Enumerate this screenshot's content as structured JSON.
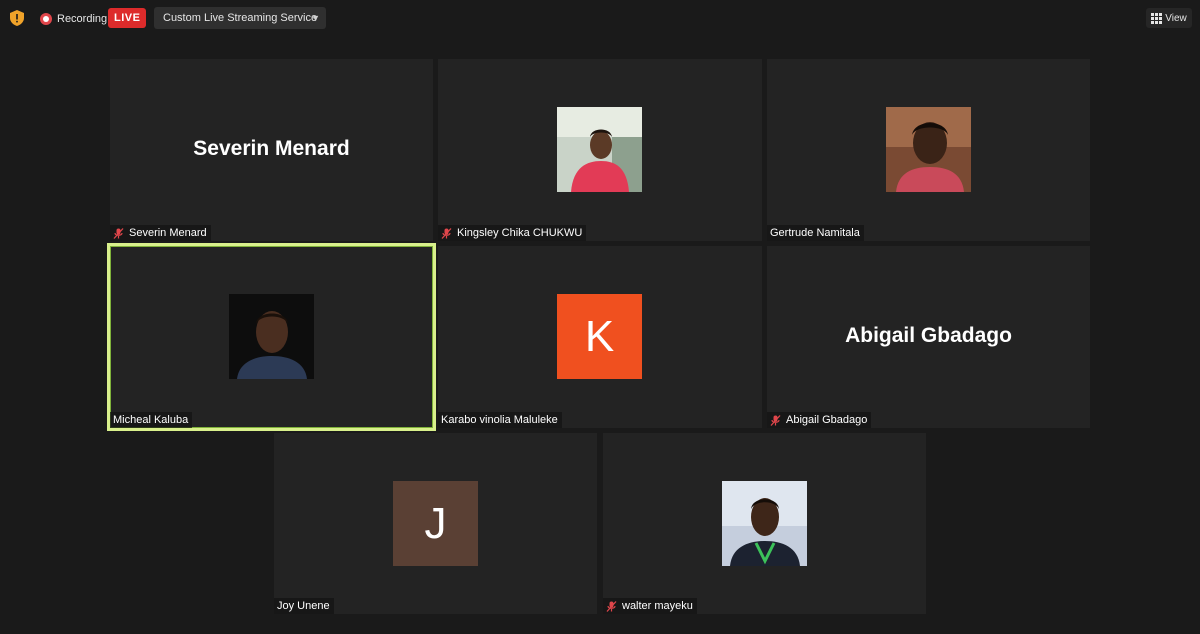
{
  "topbar": {
    "recording_label": "Recording",
    "live_label": "LIVE",
    "stream_service": "Custom Live Streaming Service",
    "view_label": "View"
  },
  "colors": {
    "background": "#1a1a1a",
    "tile": "#232323",
    "live_badge": "#dd2b2b",
    "active_speaker_border": "#d9f08c",
    "mute_icon": "#e0464b",
    "initial_k_bg": "#f0501f",
    "initial_j_bg": "#5a4034"
  },
  "participants": [
    {
      "name": "Severin Menard",
      "display": "name-text",
      "muted": true
    },
    {
      "name": "Kingsley Chika CHUKWU",
      "display": "photo",
      "muted": true
    },
    {
      "name": "Gertrude Namitala",
      "display": "photo",
      "muted": false
    },
    {
      "name": "Micheal Kaluba",
      "display": "photo",
      "muted": false,
      "active_speaker": true
    },
    {
      "name": "Karabo vinolia Maluleke",
      "display": "initial",
      "initial": "K",
      "muted": false
    },
    {
      "name": "Abigail Gbadago",
      "display": "name-text",
      "muted": true
    },
    {
      "name": "Joy Unene",
      "display": "initial",
      "initial": "J",
      "muted": false
    },
    {
      "name": "walter mayeku",
      "display": "photo",
      "muted": true
    }
  ]
}
